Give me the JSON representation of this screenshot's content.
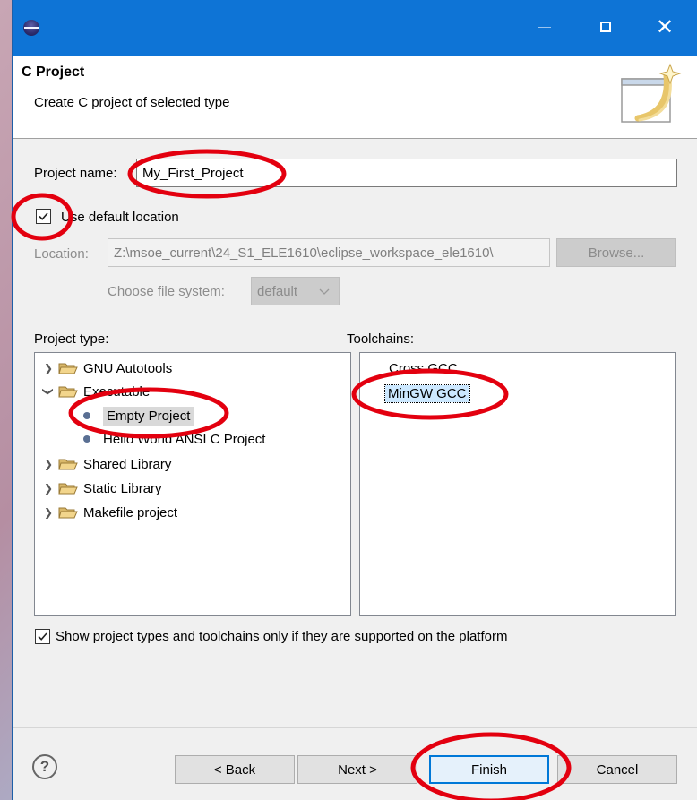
{
  "header": {
    "title": "C Project",
    "description": "Create C project of selected type"
  },
  "form": {
    "project_name_label": "Project name:",
    "project_name_value": "My_First_Project",
    "use_default_location_label": "Use default location",
    "use_default_location_checked": true,
    "location_label": "Location:",
    "location_value": "Z:\\msoe_current\\24_S1_ELE1610\\eclipse_workspace_ele1610\\",
    "browse_label": "Browse...",
    "file_system_label": "Choose file system:",
    "file_system_value": "default"
  },
  "project_type": {
    "label": "Project type:",
    "items": [
      {
        "label": "GNU Autotools",
        "kind": "folder",
        "expanded": false
      },
      {
        "label": "Executable",
        "kind": "folder",
        "expanded": true
      },
      {
        "label": "Empty Project",
        "kind": "leaf",
        "selected": true
      },
      {
        "label": "Hello World ANSI C Project",
        "kind": "leaf"
      },
      {
        "label": "Shared Library",
        "kind": "folder",
        "expanded": false
      },
      {
        "label": "Static Library",
        "kind": "folder",
        "expanded": false
      },
      {
        "label": "Makefile project",
        "kind": "folder",
        "expanded": false
      }
    ]
  },
  "toolchains": {
    "label": "Toolchains:",
    "items": [
      {
        "label": "Cross GCC"
      },
      {
        "label": "MinGW GCC",
        "selected": true
      }
    ]
  },
  "filter_checkbox": {
    "label": "Show project types and toolchains only if they are supported on the platform",
    "checked": true
  },
  "buttons": {
    "help": "?",
    "back": "< Back",
    "next": "Next >",
    "finish": "Finish",
    "cancel": "Cancel"
  },
  "icons": {
    "window": "eclipse-icon",
    "minimize": "minimize-icon",
    "maximize": "maximize-icon",
    "close": "close-icon",
    "folder": "folder-icon",
    "help": "help-icon"
  },
  "colors": {
    "titlebar": "#0e74d6",
    "annotation": "#e3000f",
    "selection": "#cce8ff"
  }
}
